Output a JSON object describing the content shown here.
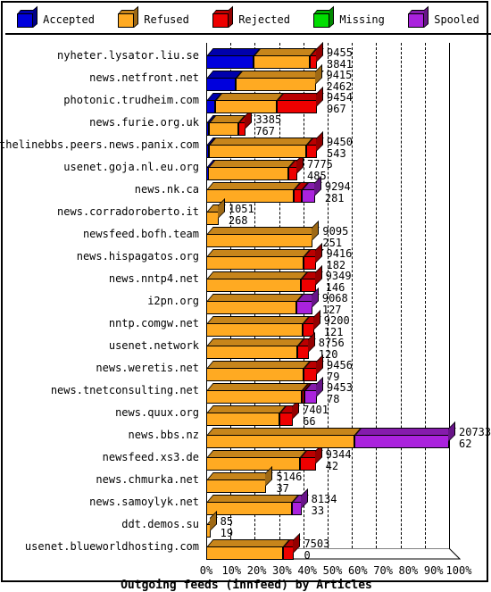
{
  "legend": {
    "items": [
      {
        "label": "Accepted",
        "color": "#0000dd",
        "icon": "legend-cube-accepted"
      },
      {
        "label": "Refused",
        "color": "#ffaa22",
        "icon": "legend-cube-refused"
      },
      {
        "label": "Rejected",
        "color": "#ee0000",
        "icon": "legend-cube-rejected"
      },
      {
        "label": "Missing",
        "color": "#00dd00",
        "icon": "legend-cube-missing"
      },
      {
        "label": "Spooled",
        "color": "#aa22dd",
        "icon": "legend-cube-spooled"
      }
    ]
  },
  "axis": {
    "x_title": "Outgoing feeds (innfeed) by Articles",
    "x_ticks": [
      "0%",
      "10%",
      "20%",
      "30%",
      "40%",
      "50%",
      "60%",
      "70%",
      "80%",
      "90%",
      "100%"
    ],
    "x_min": 0,
    "x_max": 100,
    "grid": true
  },
  "chart_data": {
    "type": "bar",
    "orientation": "horizontal",
    "stacked": true,
    "title": "",
    "xlabel": "Outgoing feeds (innfeed) by Articles",
    "ylabel": "",
    "xlim": [
      0,
      100
    ],
    "xtick_labels": [
      "0%",
      "10%",
      "20%",
      "30%",
      "40%",
      "50%",
      "60%",
      "70%",
      "80%",
      "90%",
      "100%"
    ],
    "series": [
      {
        "name": "Accepted",
        "color": "#0000dd"
      },
      {
        "name": "Refused",
        "color": "#ffaa22"
      },
      {
        "name": "Rejected",
        "color": "#ee0000"
      },
      {
        "name": "Missing",
        "color": "#00dd00"
      },
      {
        "name": "Spooled",
        "color": "#aa22dd"
      }
    ],
    "legend_position": "top",
    "categories": [
      "nyheter.lysator.liu.se",
      "news.netfront.net",
      "photonic.trudheim.com",
      "news.furie.org.uk",
      "endofthelinebbs.peers.news.panix.com",
      "usenet.goja.nl.eu.org",
      "news.nk.ca",
      "news.corradoroberto.it",
      "newsfeed.bofh.team",
      "news.hispagatos.org",
      "news.nntp4.net",
      "i2pn.org",
      "nntp.comgw.net",
      "usenet.network",
      "news.weretis.net",
      "news.tnetconsulting.net",
      "news.quux.org",
      "news.bbs.nz",
      "newsfeed.xs3.de",
      "news.chmurka.net",
      "news.samoylyk.net",
      "ddt.demos.su",
      "usenet.blueworldhosting.com"
    ],
    "rows": [
      {
        "site": "nyheter.lysator.liu.se",
        "total": 9455,
        "second": 3841,
        "pct_total": 45.6,
        "segments": [
          {
            "name": "Accepted",
            "pct": 19.4
          },
          {
            "name": "Refused",
            "pct": 23.2
          },
          {
            "name": "Rejected",
            "pct": 3.0
          }
        ]
      },
      {
        "site": "news.netfront.net",
        "total": 9415,
        "second": 2462,
        "pct_total": 45.4,
        "segments": [
          {
            "name": "Accepted",
            "pct": 12.0
          },
          {
            "name": "Refused",
            "pct": 33.4
          }
        ]
      },
      {
        "site": "photonic.trudheim.com",
        "total": 9454,
        "second": 967,
        "pct_total": 45.6,
        "segments": [
          {
            "name": "Accepted",
            "pct": 3.6
          },
          {
            "name": "Refused",
            "pct": 25.5
          },
          {
            "name": "Rejected",
            "pct": 16.5
          }
        ]
      },
      {
        "site": "news.furie.org.uk",
        "total": 3385,
        "second": 767,
        "pct_total": 16.3,
        "segments": [
          {
            "name": "Accepted",
            "pct": 1.2
          },
          {
            "name": "Refused",
            "pct": 12.0
          },
          {
            "name": "Rejected",
            "pct": 3.1
          }
        ]
      },
      {
        "site": "endofthelinebbs.peers.news.panix.com",
        "total": 9450,
        "second": 543,
        "pct_total": 45.6,
        "segments": [
          {
            "name": "Accepted",
            "pct": 1.0
          },
          {
            "name": "Refused",
            "pct": 40.1
          },
          {
            "name": "Rejected",
            "pct": 4.5
          }
        ]
      },
      {
        "site": "usenet.goja.nl.eu.org",
        "total": 7775,
        "second": 485,
        "pct_total": 37.5,
        "segments": [
          {
            "name": "Accepted",
            "pct": 0.8
          },
          {
            "name": "Refused",
            "pct": 33.0
          },
          {
            "name": "Rejected",
            "pct": 3.7
          }
        ]
      },
      {
        "site": "news.nk.ca",
        "total": 9294,
        "second": 281,
        "pct_total": 44.8,
        "segments": [
          {
            "name": "Refused",
            "pct": 36.0
          },
          {
            "name": "Rejected",
            "pct": 3.3
          },
          {
            "name": "Spooled",
            "pct": 5.5
          }
        ]
      },
      {
        "site": "news.corradoroberto.it",
        "total": 1051,
        "second": 268,
        "pct_total": 5.1,
        "segments": [
          {
            "name": "Refused",
            "pct": 5.1
          }
        ]
      },
      {
        "site": "newsfeed.bofh.team",
        "total": 9095,
        "second": 251,
        "pct_total": 43.9,
        "segments": [
          {
            "name": "Refused",
            "pct": 43.9
          }
        ]
      },
      {
        "site": "news.hispagatos.org",
        "total": 9416,
        "second": 182,
        "pct_total": 45.4,
        "segments": [
          {
            "name": "Refused",
            "pct": 40.0
          },
          {
            "name": "Rejected",
            "pct": 5.4
          }
        ]
      },
      {
        "site": "news.nntp4.net",
        "total": 9349,
        "second": 146,
        "pct_total": 45.1,
        "segments": [
          {
            "name": "Refused",
            "pct": 39.0
          },
          {
            "name": "Rejected",
            "pct": 6.1
          }
        ]
      },
      {
        "site": "i2pn.org",
        "total": 9068,
        "second": 127,
        "pct_total": 43.7,
        "segments": [
          {
            "name": "Refused",
            "pct": 37.2
          },
          {
            "name": "Spooled",
            "pct": 6.5
          }
        ]
      },
      {
        "site": "nntp.comgw.net",
        "total": 9200,
        "second": 121,
        "pct_total": 44.4,
        "segments": [
          {
            "name": "Refused",
            "pct": 39.7
          },
          {
            "name": "Rejected",
            "pct": 4.7
          }
        ]
      },
      {
        "site": "usenet.network",
        "total": 8756,
        "second": 120,
        "pct_total": 42.2,
        "segments": [
          {
            "name": "Refused",
            "pct": 37.6
          },
          {
            "name": "Rejected",
            "pct": 4.6
          }
        ]
      },
      {
        "site": "news.weretis.net",
        "total": 9456,
        "second": 79,
        "pct_total": 45.6,
        "segments": [
          {
            "name": "Refused",
            "pct": 40.2
          },
          {
            "name": "Rejected",
            "pct": 5.4
          }
        ]
      },
      {
        "site": "news.tnetconsulting.net",
        "total": 9453,
        "second": 78,
        "pct_total": 45.6,
        "segments": [
          {
            "name": "Refused",
            "pct": 39.5
          },
          {
            "name": "Rejected",
            "pct": 1.0
          },
          {
            "name": "Spooled",
            "pct": 5.1
          }
        ]
      },
      {
        "site": "news.quux.org",
        "total": 7401,
        "second": 66,
        "pct_total": 35.7,
        "segments": [
          {
            "name": "Refused",
            "pct": 30.3
          },
          {
            "name": "Rejected",
            "pct": 5.4
          }
        ]
      },
      {
        "site": "news.bbs.nz",
        "total": 20733,
        "second": 62,
        "pct_total": 100.0,
        "segments": [
          {
            "name": "Refused",
            "pct": 61.0
          },
          {
            "name": "Spooled",
            "pct": 39.0
          }
        ]
      },
      {
        "site": "newsfeed.xs3.de",
        "total": 9344,
        "second": 42,
        "pct_total": 45.1,
        "segments": [
          {
            "name": "Refused",
            "pct": 38.5
          },
          {
            "name": "Rejected",
            "pct": 6.6
          }
        ]
      },
      {
        "site": "news.chmurka.net",
        "total": 5146,
        "second": 37,
        "pct_total": 24.8,
        "segments": [
          {
            "name": "Refused",
            "pct": 24.8
          }
        ]
      },
      {
        "site": "news.samoylyk.net",
        "total": 8134,
        "second": 33,
        "pct_total": 39.2,
        "segments": [
          {
            "name": "Refused",
            "pct": 35.2
          },
          {
            "name": "Spooled",
            "pct": 4.0
          }
        ]
      },
      {
        "site": "ddt.demos.su",
        "total": 85,
        "second": 19,
        "pct_total": 1.7,
        "segments": [
          {
            "name": "Refused",
            "pct": 1.7
          }
        ]
      },
      {
        "site": "usenet.blueworldhosting.com",
        "total": 7503,
        "second": 0,
        "pct_total": 36.2,
        "segments": [
          {
            "name": "Refused",
            "pct": 31.8
          },
          {
            "name": "Rejected",
            "pct": 4.4
          }
        ]
      }
    ]
  }
}
